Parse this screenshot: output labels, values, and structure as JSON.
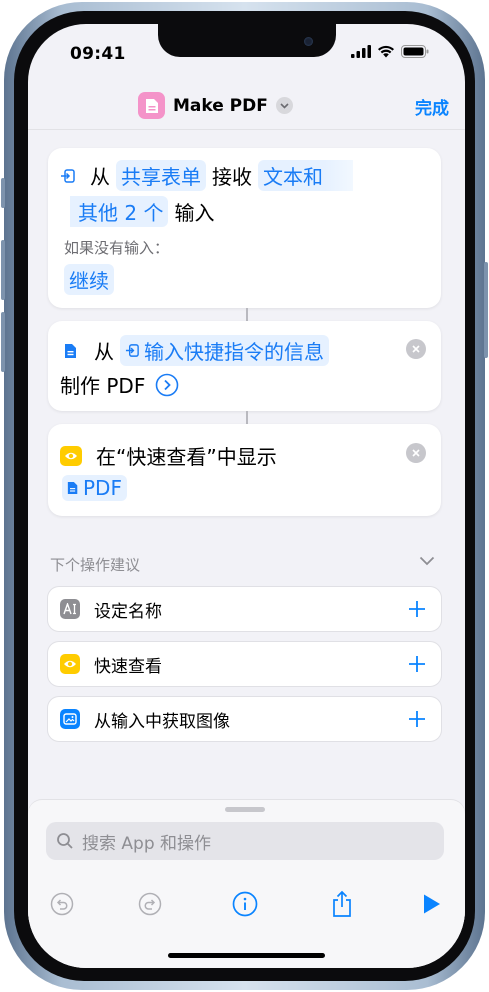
{
  "status_bar": {
    "time": "09:41"
  },
  "nav": {
    "title": "Make PDF",
    "done_label": "完成",
    "app_icon": "doc-icon",
    "accent": "#0a84ff",
    "icon_color": "#f493c9"
  },
  "action1": {
    "from": "从",
    "source_chip": "共享表单",
    "receive": "接收",
    "types_part1": "文本和",
    "types_part2": "其他 2 个",
    "input_word": "输入",
    "if_no_input": "如果没有输入：",
    "continue_chip": "继续"
  },
  "action2": {
    "from": "从",
    "input_chip": "输入快捷指令的信息",
    "make_pdf": "制作 PDF"
  },
  "action3": {
    "show_in": "在“快速查看”中显示",
    "pdf_chip": "PDF"
  },
  "suggestions": {
    "header": "下个操作建议",
    "items": [
      {
        "label": "设定名称",
        "icon": "text-cursor-icon",
        "color": "#8e8e93"
      },
      {
        "label": "快速查看",
        "icon": "eye-icon",
        "color": "#ffcc00"
      },
      {
        "label": "从输入中获取图像",
        "icon": "image-icon",
        "color": "#0a84ff"
      }
    ]
  },
  "search": {
    "placeholder": "搜索 App 和操作"
  }
}
